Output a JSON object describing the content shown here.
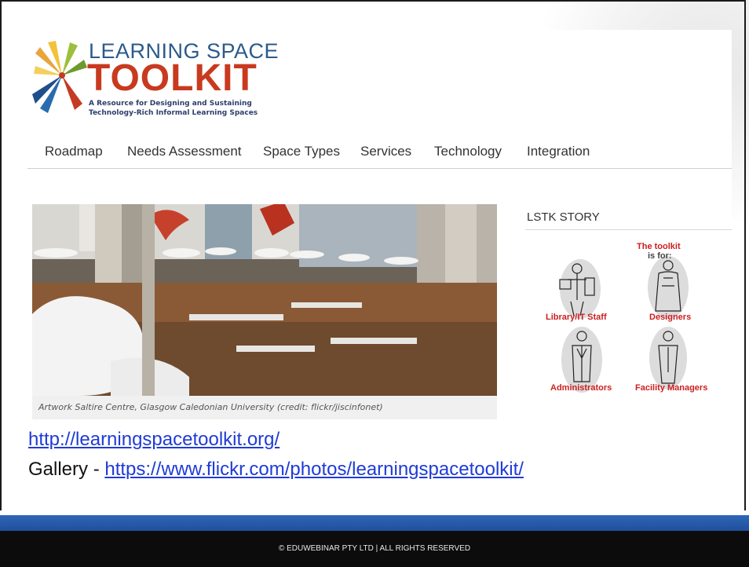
{
  "logo": {
    "title_line1": "LEARNING SPACE",
    "title_line2": "TOOLKIT",
    "subtitle_line1": "A Resource for Designing and Sustaining",
    "subtitle_line2": "Technology-Rich Informal Learning Spaces"
  },
  "nav": {
    "items": [
      {
        "label": "Roadmap"
      },
      {
        "label": "Needs Assessment"
      },
      {
        "label": "Space Types"
      },
      {
        "label": "Services"
      },
      {
        "label": "Technology"
      },
      {
        "label": "Integration"
      }
    ]
  },
  "hero": {
    "caption": "Artwork Saltire Centre, Glasgow Caledonian University (credit: flickr/jiscinfonet)"
  },
  "sidebar": {
    "title": "LSTK STORY",
    "toolkit": {
      "heading1": "The toolkit",
      "heading2": "is for:",
      "roles": [
        "Library/IT Staff",
        "Designers",
        "Administrators",
        "Facility Managers"
      ]
    }
  },
  "links": {
    "main_url": "http://learningspacetoolkit.org/",
    "gallery_prefix": "Gallery - ",
    "gallery_url": "https://www.flickr.com/photos/learningspacetoolkit/"
  },
  "footer": {
    "text": "© EDUWEBINAR PTY LTD | ALL RIGHTS RESERVED"
  },
  "colors": {
    "logo_blue": "#2b5a8c",
    "logo_red": "#c83a1f",
    "link_blue": "#1f3bd6",
    "band_blue": "#2f67b8",
    "footer_black": "#0c0c0c",
    "role_red": "#cc1f1f"
  }
}
